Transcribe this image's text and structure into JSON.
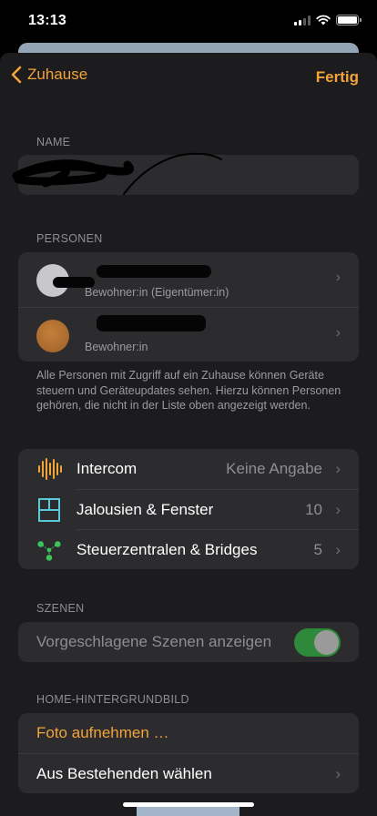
{
  "status_bar": {
    "time": "13:13"
  },
  "nav": {
    "back_label": "Zuhause",
    "done_label": "Fertig"
  },
  "name_section": {
    "header": "NAME"
  },
  "people_section": {
    "header": "PERSONEN",
    "people": [
      {
        "role": "Bewohner:in (Eigentümer:in)"
      },
      {
        "role": "Bewohner:in"
      }
    ],
    "info": "Alle Personen mit Zugriff auf ein Zuhause können Geräte steuern und Geräteupdates sehen. Hierzu können Personen gehören, die nicht in der Liste oben angezeigt werden."
  },
  "accessories": [
    {
      "label": "Intercom",
      "value": "Keine Angabe",
      "icon": "intercom-waveform-icon"
    },
    {
      "label": "Jalousien & Fenster",
      "value": "10",
      "icon": "window-icon"
    },
    {
      "label": "Steuerzentralen & Bridges",
      "value": "5",
      "icon": "hub-network-icon"
    }
  ],
  "scenes_section": {
    "header": "SZENEN",
    "toggle_label": "Vorgeschlagene Szenen anzeigen",
    "toggle_on": true
  },
  "wallpaper_section": {
    "header": "HOME-HINTERGRUNDBILD",
    "take_photo": "Foto aufnehmen …",
    "choose_existing": "Aus Bestehenden wählen"
  },
  "colors": {
    "accent": "#f2a33a",
    "background": "#1c1c1e",
    "cell": "#2c2c2e",
    "toggle_on": "#2e8a3a"
  }
}
